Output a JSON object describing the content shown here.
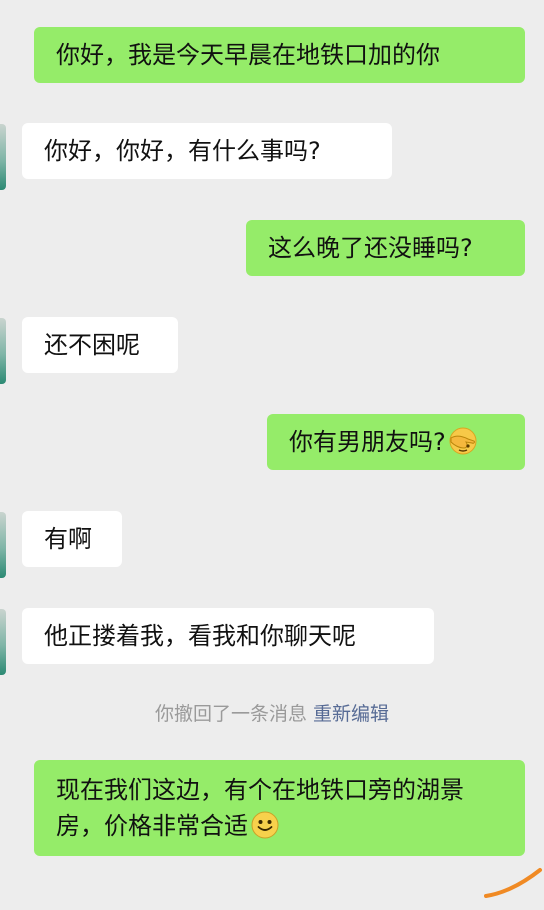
{
  "messages": [
    {
      "side": "sent",
      "text": "你好，我是今天早晨在地铁口加的你"
    },
    {
      "side": "received",
      "text": "你好，你好，有什么事吗?"
    },
    {
      "side": "sent",
      "text": "这么晚了还没睡吗?"
    },
    {
      "side": "received",
      "text": "还不困呢"
    },
    {
      "side": "sent",
      "text": "你有男朋友吗?",
      "emoji": "hand-facepalm-emoji"
    },
    {
      "side": "received",
      "text": "有啊"
    },
    {
      "side": "received",
      "text": "他正搂着我，看我和你聊天呢"
    },
    {
      "side": "sent",
      "text": "现在我们这边，有个在地铁口旁的湖景房，价格非常合适",
      "emoji": "smiley-face-emoji"
    }
  ],
  "system_note": {
    "text": "你撤回了一条消息",
    "action_label": "重新编辑"
  },
  "colors": {
    "sent_bubble": "#95ec69",
    "received_bubble": "#ffffff",
    "background": "#ededed",
    "link": "#576b95"
  }
}
